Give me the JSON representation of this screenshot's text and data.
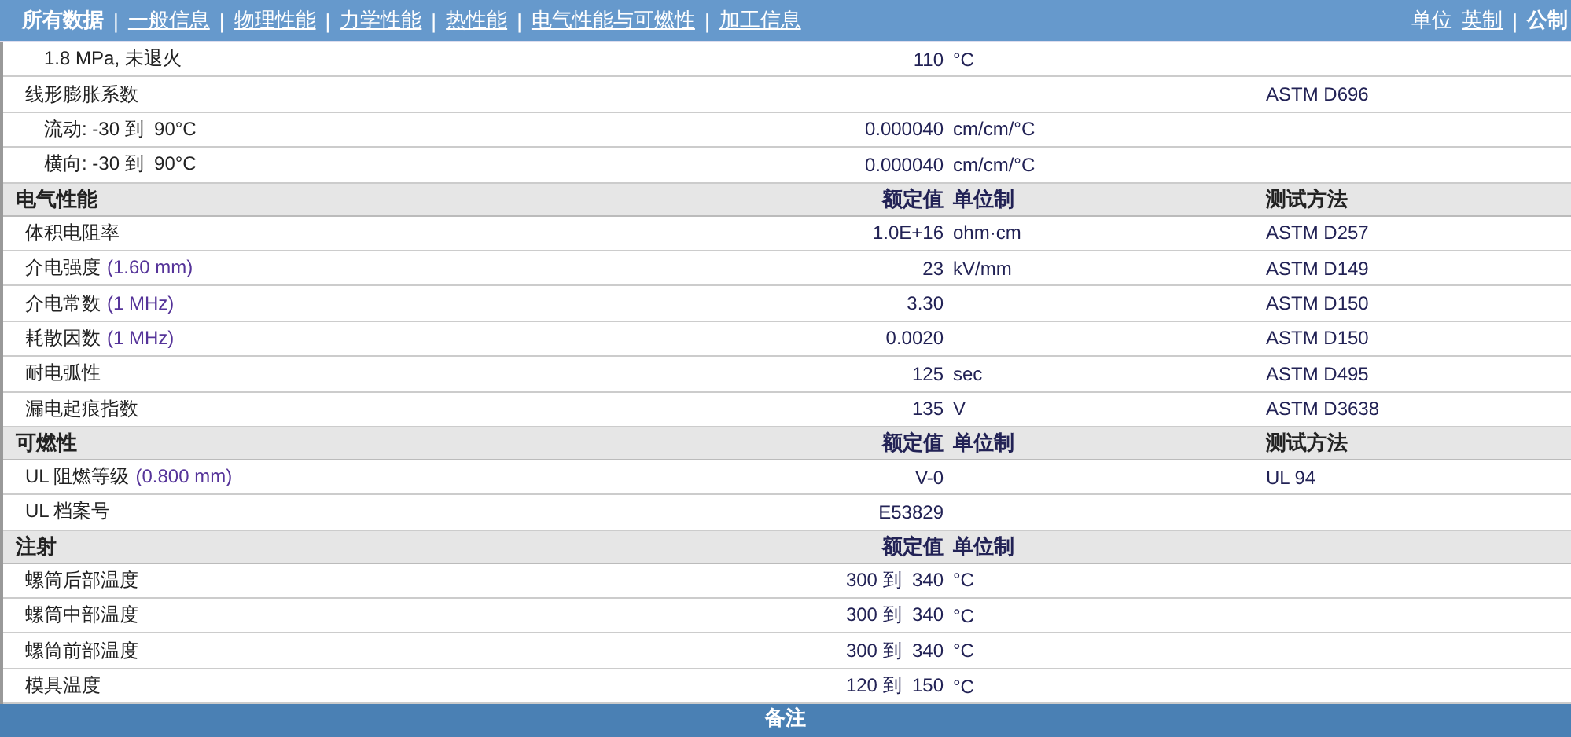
{
  "nav": {
    "separator": "|",
    "tabs": [
      {
        "label": "所有数据",
        "selected": true
      },
      {
        "label": "一般信息",
        "selected": false
      },
      {
        "label": "物理性能",
        "selected": false
      },
      {
        "label": "力学性能",
        "selected": false
      },
      {
        "label": "热性能",
        "selected": false
      },
      {
        "label": "电气性能与可燃性",
        "selected": false
      },
      {
        "label": "加工信息",
        "selected": false
      }
    ],
    "units": {
      "label": "单位",
      "separator": "|",
      "options": [
        {
          "label": "英制",
          "selected": false
        },
        {
          "label": "公制",
          "selected": true
        }
      ]
    }
  },
  "sections": [
    {
      "rows": [
        {
          "kind": "condition",
          "name": "1.8 MPa, 未退火",
          "value": "110",
          "unit": "°C"
        },
        {
          "kind": "property",
          "name": "线形膨胀系数",
          "method": "ASTM D696",
          "children": [
            {
              "name": "流动: -30 到  90°C",
              "value": "0.000040",
              "unit": "cm/cm/°C"
            },
            {
              "name": "横向: -30 到  90°C",
              "value": "0.000040",
              "unit": "cm/cm/°C"
            }
          ]
        }
      ]
    },
    {
      "title": "电气性能",
      "columns": {
        "value": "额定值",
        "unit": "单位制",
        "method": "测试方法"
      },
      "rows": [
        {
          "kind": "property",
          "name": "体积电阻率",
          "value": "1.0E+16",
          "unit": "ohm·cm",
          "method": "ASTM D257"
        },
        {
          "kind": "property",
          "name": "介电强度",
          "condition": "(1.60 mm)",
          "value": "23",
          "unit": "kV/mm",
          "method": "ASTM D149"
        },
        {
          "kind": "property",
          "name": "介电常数",
          "condition": "(1 MHz)",
          "value": "3.30",
          "method": "ASTM D150"
        },
        {
          "kind": "property",
          "name": "耗散因数",
          "condition": "(1 MHz)",
          "value": "0.0020",
          "method": "ASTM D150"
        },
        {
          "kind": "property",
          "name": "耐电弧性",
          "value": "125",
          "unit": "sec",
          "method": "ASTM D495"
        },
        {
          "kind": "property",
          "name": "漏电起痕指数",
          "value": "135",
          "unit": "V",
          "method": "ASTM D3638"
        }
      ]
    },
    {
      "title": "可燃性",
      "columns": {
        "value": "额定值",
        "unit": "单位制",
        "method": "测试方法"
      },
      "rows": [
        {
          "kind": "property",
          "name": "UL 阻燃等级",
          "condition": "(0.800 mm)",
          "value": "V-0",
          "method": "UL 94"
        },
        {
          "kind": "property",
          "name": "UL 档案号",
          "value": "E53829"
        }
      ]
    },
    {
      "title": "注射",
      "columns": {
        "value": "额定值",
        "unit": "单位制"
      },
      "rows": [
        {
          "kind": "property",
          "name": "螺筒后部温度",
          "value": "300 到  340",
          "unit": "°C"
        },
        {
          "kind": "property",
          "name": "螺筒中部温度",
          "value": "300 到  340",
          "unit": "°C"
        },
        {
          "kind": "property",
          "name": "螺筒前部温度",
          "value": "300 到  340",
          "unit": "°C"
        },
        {
          "kind": "property",
          "name": "模具温度",
          "value": "120 到  150",
          "unit": "°C"
        }
      ]
    }
  ],
  "footer": {
    "title": "备注"
  }
}
